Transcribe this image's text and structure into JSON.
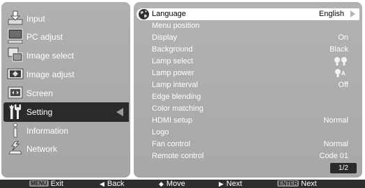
{
  "left_menu": {
    "items": [
      {
        "label": "Input",
        "icon": "input-icon"
      },
      {
        "label": "PC adjust",
        "icon": "pc-adjust-icon"
      },
      {
        "label": "Image select",
        "icon": "image-select-icon"
      },
      {
        "label": "Image adjust",
        "icon": "image-adjust-icon"
      },
      {
        "label": "Screen",
        "icon": "screen-icon"
      },
      {
        "label": "Setting",
        "icon": "setting-icon",
        "selected": true
      },
      {
        "label": "Information",
        "icon": "information-icon"
      },
      {
        "label": "Network",
        "icon": "network-icon"
      }
    ]
  },
  "settings": {
    "rows": [
      {
        "label": "Language",
        "value": "English",
        "selected": true
      },
      {
        "label": "Menu position",
        "value": ""
      },
      {
        "label": "Display",
        "value": "On"
      },
      {
        "label": "Background",
        "value": "Black"
      },
      {
        "label": "Lamp select",
        "value": "",
        "icon": "dual-lamp-icon"
      },
      {
        "label": "Lamp power",
        "value": "",
        "icon": "lamp-power-auto-icon"
      },
      {
        "label": "Lamp interval",
        "value": "Off"
      },
      {
        "label": "Edge blending",
        "value": ""
      },
      {
        "label": "Color matching",
        "value": ""
      },
      {
        "label": "HDMI setup",
        "value": "Normal"
      },
      {
        "label": "Logo",
        "value": ""
      },
      {
        "label": "Fan control",
        "value": "Normal"
      },
      {
        "label": "Remote control",
        "value": "Code 01"
      }
    ],
    "page_indicator": "1/2",
    "lamp_power_badge": "A"
  },
  "footer": {
    "exit": {
      "key": "MENU",
      "label": "Exit"
    },
    "back": {
      "label": "Back"
    },
    "move": {
      "label": "Move"
    },
    "next": {
      "label": "Next"
    },
    "enter_next": {
      "key": "ENTER",
      "label": "Next"
    }
  },
  "colors": {
    "panel": "#aaaaaa",
    "selected_menu": "#2b2b2b",
    "selected_row": "#ffffff",
    "bottom_bar": "#2e2e2e"
  }
}
